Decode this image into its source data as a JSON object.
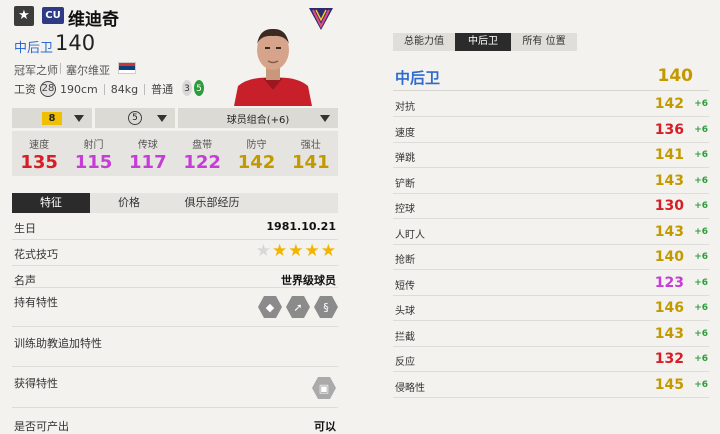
{
  "player": {
    "star_icon": "★",
    "season_badge": "CU",
    "name": "维迪奇",
    "position": "中后卫",
    "position_ovr": "140",
    "club_honor": "冠军之师",
    "nationality": "塞尔维亚",
    "wage_label": "工资",
    "wage": "28",
    "height": "190cm",
    "weight": "84kg",
    "body_type": "普通",
    "weak_foot": "3",
    "strong_foot": "5"
  },
  "selectors": {
    "level": "8",
    "reinforce": "5",
    "combo": "球员组合(+6)"
  },
  "main_stats": [
    {
      "label": "速度",
      "value": "135",
      "color": "#d41f26"
    },
    {
      "label": "射门",
      "value": "115",
      "color": "#c53cd6"
    },
    {
      "label": "传球",
      "value": "117",
      "color": "#c53cd6"
    },
    {
      "label": "盘带",
      "value": "122",
      "color": "#c53cd6"
    },
    {
      "label": "防守",
      "value": "142",
      "color": "#c29a00"
    },
    {
      "label": "强壮",
      "value": "141",
      "color": "#c29a00"
    }
  ],
  "tabs": [
    "特征",
    "价格",
    "俱乐部经历"
  ],
  "details": {
    "birthday_label": "生日",
    "birthday": "1981.10.21",
    "skill_moves_label": "花式技巧",
    "skill_moves_stars": 4,
    "reputation_label": "名声",
    "reputation": "世界级球员",
    "traits_label": "持有特性",
    "training_traits_label": "训练助教追加特性",
    "acquired_traits_label": "获得特性",
    "producible_label": "是否可产出",
    "producible": "可以"
  },
  "right_tabs": [
    "总能力值",
    "中后卫",
    "所有 位置"
  ],
  "right_header": {
    "position": "中后卫",
    "ovr": "140"
  },
  "attributes": [
    {
      "name": "对抗",
      "value": "142",
      "bonus": "+6",
      "color": "#c29a00"
    },
    {
      "name": "速度",
      "value": "136",
      "bonus": "+6",
      "color": "#d41f26"
    },
    {
      "name": "弹跳",
      "value": "141",
      "bonus": "+6",
      "color": "#c29a00"
    },
    {
      "name": "铲断",
      "value": "143",
      "bonus": "+6",
      "color": "#c29a00"
    },
    {
      "name": "控球",
      "value": "130",
      "bonus": "+6",
      "color": "#d41f26"
    },
    {
      "name": "人盯人",
      "value": "143",
      "bonus": "+6",
      "color": "#c29a00"
    },
    {
      "name": "抢断",
      "value": "140",
      "bonus": "+6",
      "color": "#c29a00"
    },
    {
      "name": "短传",
      "value": "123",
      "bonus": "+6",
      "color": "#c53cd6"
    },
    {
      "name": "头球",
      "value": "146",
      "bonus": "+6",
      "color": "#c29a00"
    },
    {
      "name": "拦截",
      "value": "143",
      "bonus": "+6",
      "color": "#c29a00"
    },
    {
      "name": "反应",
      "value": "132",
      "bonus": "+6",
      "color": "#d41f26"
    },
    {
      "name": "侵略性",
      "value": "145",
      "bonus": "+6",
      "color": "#c29a00"
    }
  ]
}
